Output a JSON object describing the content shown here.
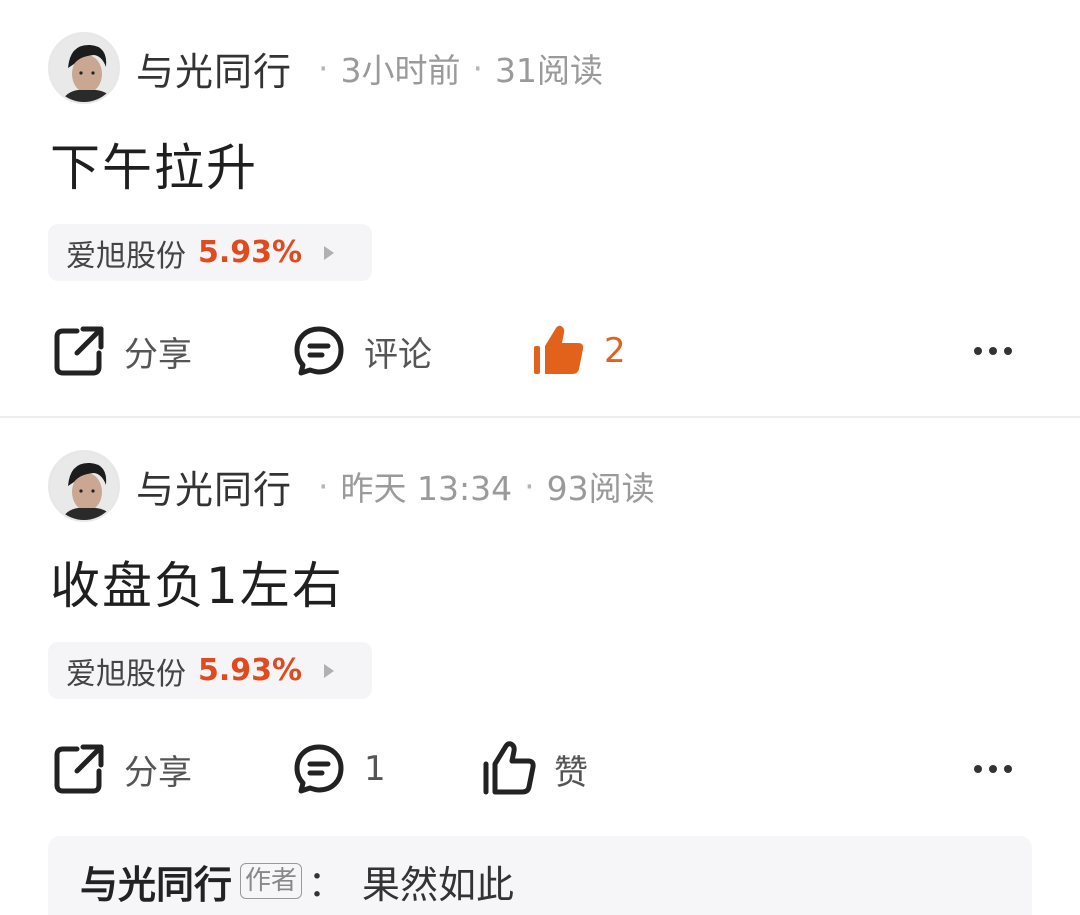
{
  "posts": [
    {
      "author": "与光同行",
      "time": "3小时前",
      "reads": "31阅读",
      "content": "下午拉升",
      "stock": {
        "name": "爱旭股份",
        "change": "5.93%"
      },
      "actions": {
        "share": "分享",
        "comment": "评论",
        "like": "2",
        "like_active": true
      }
    },
    {
      "author": "与光同行",
      "time": "昨天 13:34",
      "reads": "93阅读",
      "content": "收盘负1左右",
      "stock": {
        "name": "爱旭股份",
        "change": "5.93%"
      },
      "actions": {
        "share": "分享",
        "comment": "1",
        "like": "赞",
        "like_active": false
      },
      "comment_preview": {
        "author": "与光同行",
        "badge": "作者",
        "colon": "：",
        "text": "果然如此"
      }
    }
  ],
  "colors": {
    "accent": "#e2621b",
    "stock_up": "#e04a1c"
  },
  "icons": [
    "share-icon",
    "comment-icon",
    "thumbs-up-filled-icon",
    "thumbs-up-outline-icon",
    "more-icon"
  ]
}
